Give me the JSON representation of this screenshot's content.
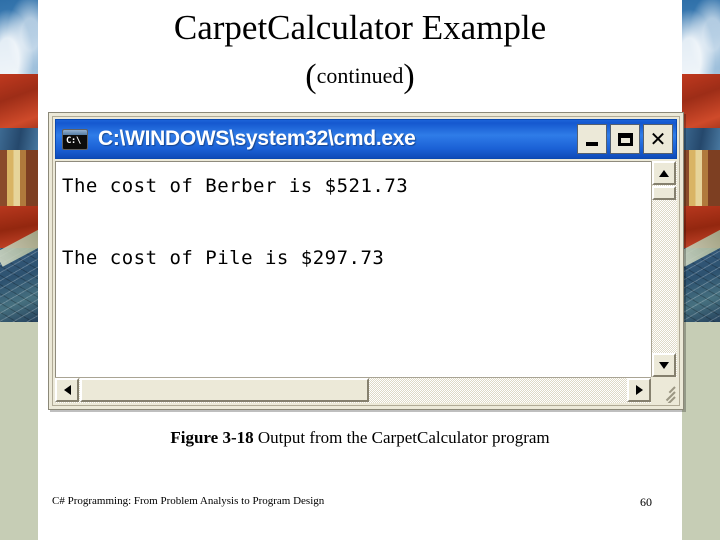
{
  "slide": {
    "title": "CarpetCalculator Example",
    "subtitle": {
      "open_paren": "(",
      "word": "continued",
      "close_paren": ")"
    },
    "caption": {
      "figure_label": "Figure 3-18",
      "figure_text": " Output from the CarpetCalculator program"
    },
    "footer": {
      "book_title": "C# Programming: From Problem Analysis to Program Design",
      "page_number": "60"
    },
    "colors": {
      "sage_band": "#c6cdb5",
      "titlebar_blue": "#1c63d8",
      "window_face": "#ece9d8",
      "console_background": "#ffffff"
    }
  },
  "cmd_window": {
    "titlebar": {
      "icon_name": "cmd-console-icon",
      "icon_text": "C:\\",
      "title": "C:\\WINDOWS\\system32\\cmd.exe",
      "buttons": {
        "minimize": "Minimize",
        "maximize": "Maximize",
        "close": "Close"
      }
    },
    "console_output": {
      "lines": [
        "The cost of Berber is $521.73",
        "",
        "The cost of Pile is $297.73"
      ],
      "text": "The cost of Berber is $521.73\n\nThe cost of Pile is $297.73"
    },
    "scrollbars": {
      "vertical": {
        "up": "Scroll up",
        "down": "Scroll down",
        "thumb": "Vertical scroll thumb"
      },
      "horizontal": {
        "left": "Scroll left",
        "right": "Scroll right",
        "thumb": "Horizontal scroll thumb"
      },
      "resize_grip": "Resize grip"
    }
  }
}
